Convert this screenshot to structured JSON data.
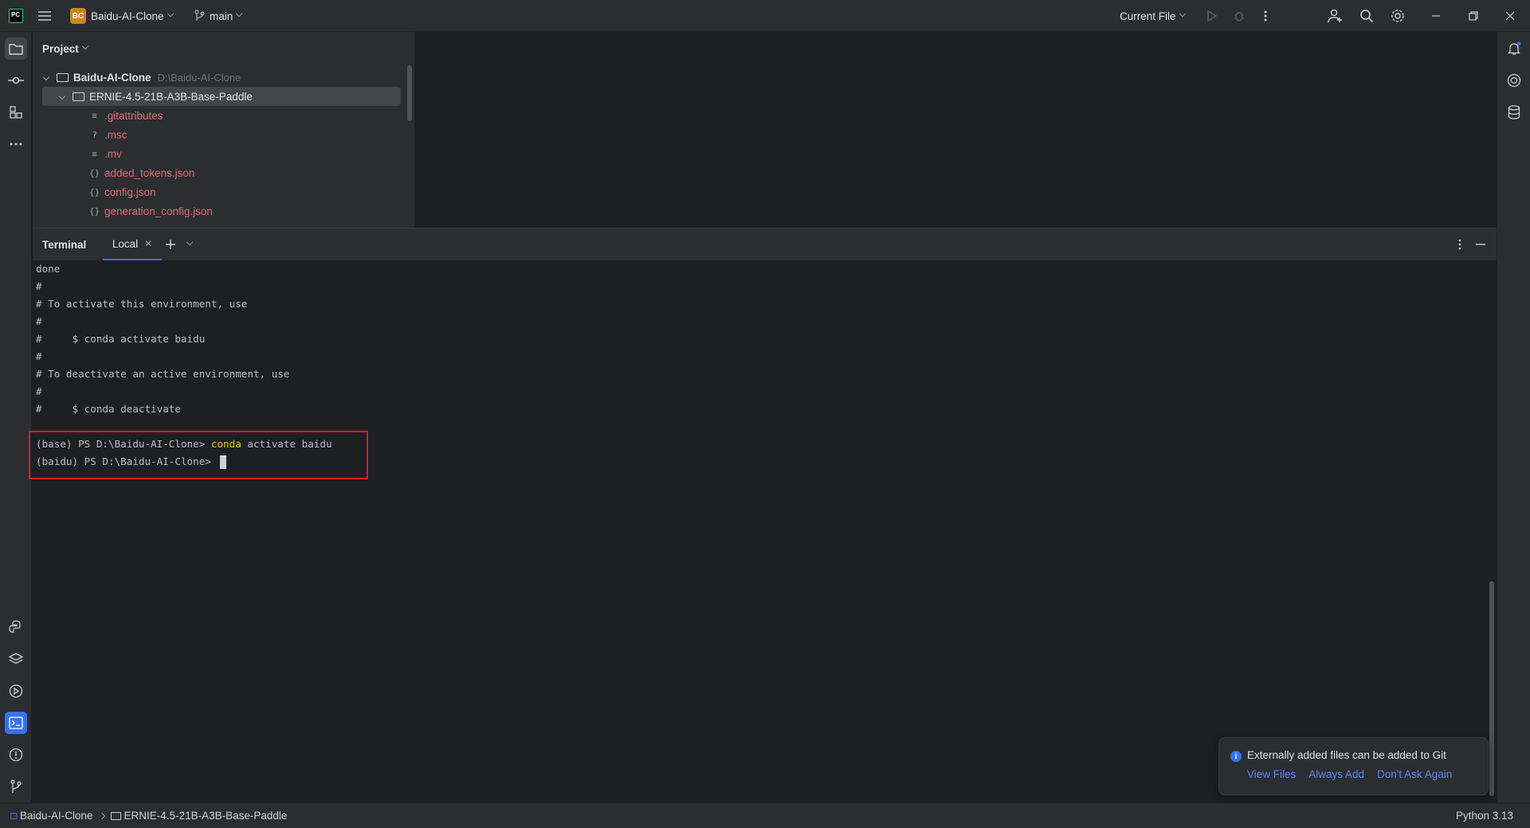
{
  "titlebar": {
    "app_logo": "PC",
    "project_badge": "BC",
    "project_name": "Baidu-AI-Clone",
    "branch": "main",
    "run_config": "Current File"
  },
  "project_panel": {
    "title": "Project",
    "tree": [
      {
        "name": "Baidu-AI-Clone",
        "path": "D:\\Baidu-AI-Clone",
        "type": "root"
      },
      {
        "name": "ERNIE-4.5-21B-A3B-Base-Paddle",
        "type": "folder"
      },
      {
        "name": ".gitattributes",
        "icon": "text-icon"
      },
      {
        "name": ".msc",
        "icon": "unknown-file-icon"
      },
      {
        "name": ".mv",
        "icon": "text-icon"
      },
      {
        "name": "added_tokens.json",
        "icon": "json-icon"
      },
      {
        "name": "config.json",
        "icon": "json-icon"
      },
      {
        "name": "generation_config.json",
        "icon": "json-icon"
      }
    ]
  },
  "terminal": {
    "title": "Terminal",
    "tab": "Local",
    "lines": [
      "done",
      "#",
      "# To activate this environment, use",
      "#",
      "#     $ conda activate baidu",
      "#",
      "# To deactivate an active environment, use",
      "#",
      "#     $ conda deactivate",
      ""
    ],
    "cmd1_prompt": "(base) PS D:\\Baidu-AI-Clone> ",
    "cmd1_kw": "conda",
    "cmd1_rest": " activate baidu",
    "cmd2_prompt": "(baidu) PS D:\\Baidu-AI-Clone> "
  },
  "notification": {
    "title": "Externally added files can be added to Git",
    "links": [
      "View Files",
      "Always Add",
      "Don't Ask Again"
    ]
  },
  "statusbar": {
    "crumb_root": "Baidu-AI-Clone",
    "crumb_folder": "ERNIE-4.5-21B-A3B-Base-Paddle",
    "interpreter": "Python 3.13"
  },
  "colors": {
    "accent": "#3574f0",
    "highlight": "#e01e1e",
    "unversioned_file": "#e06c75",
    "keyword": "#e8bf3a"
  }
}
